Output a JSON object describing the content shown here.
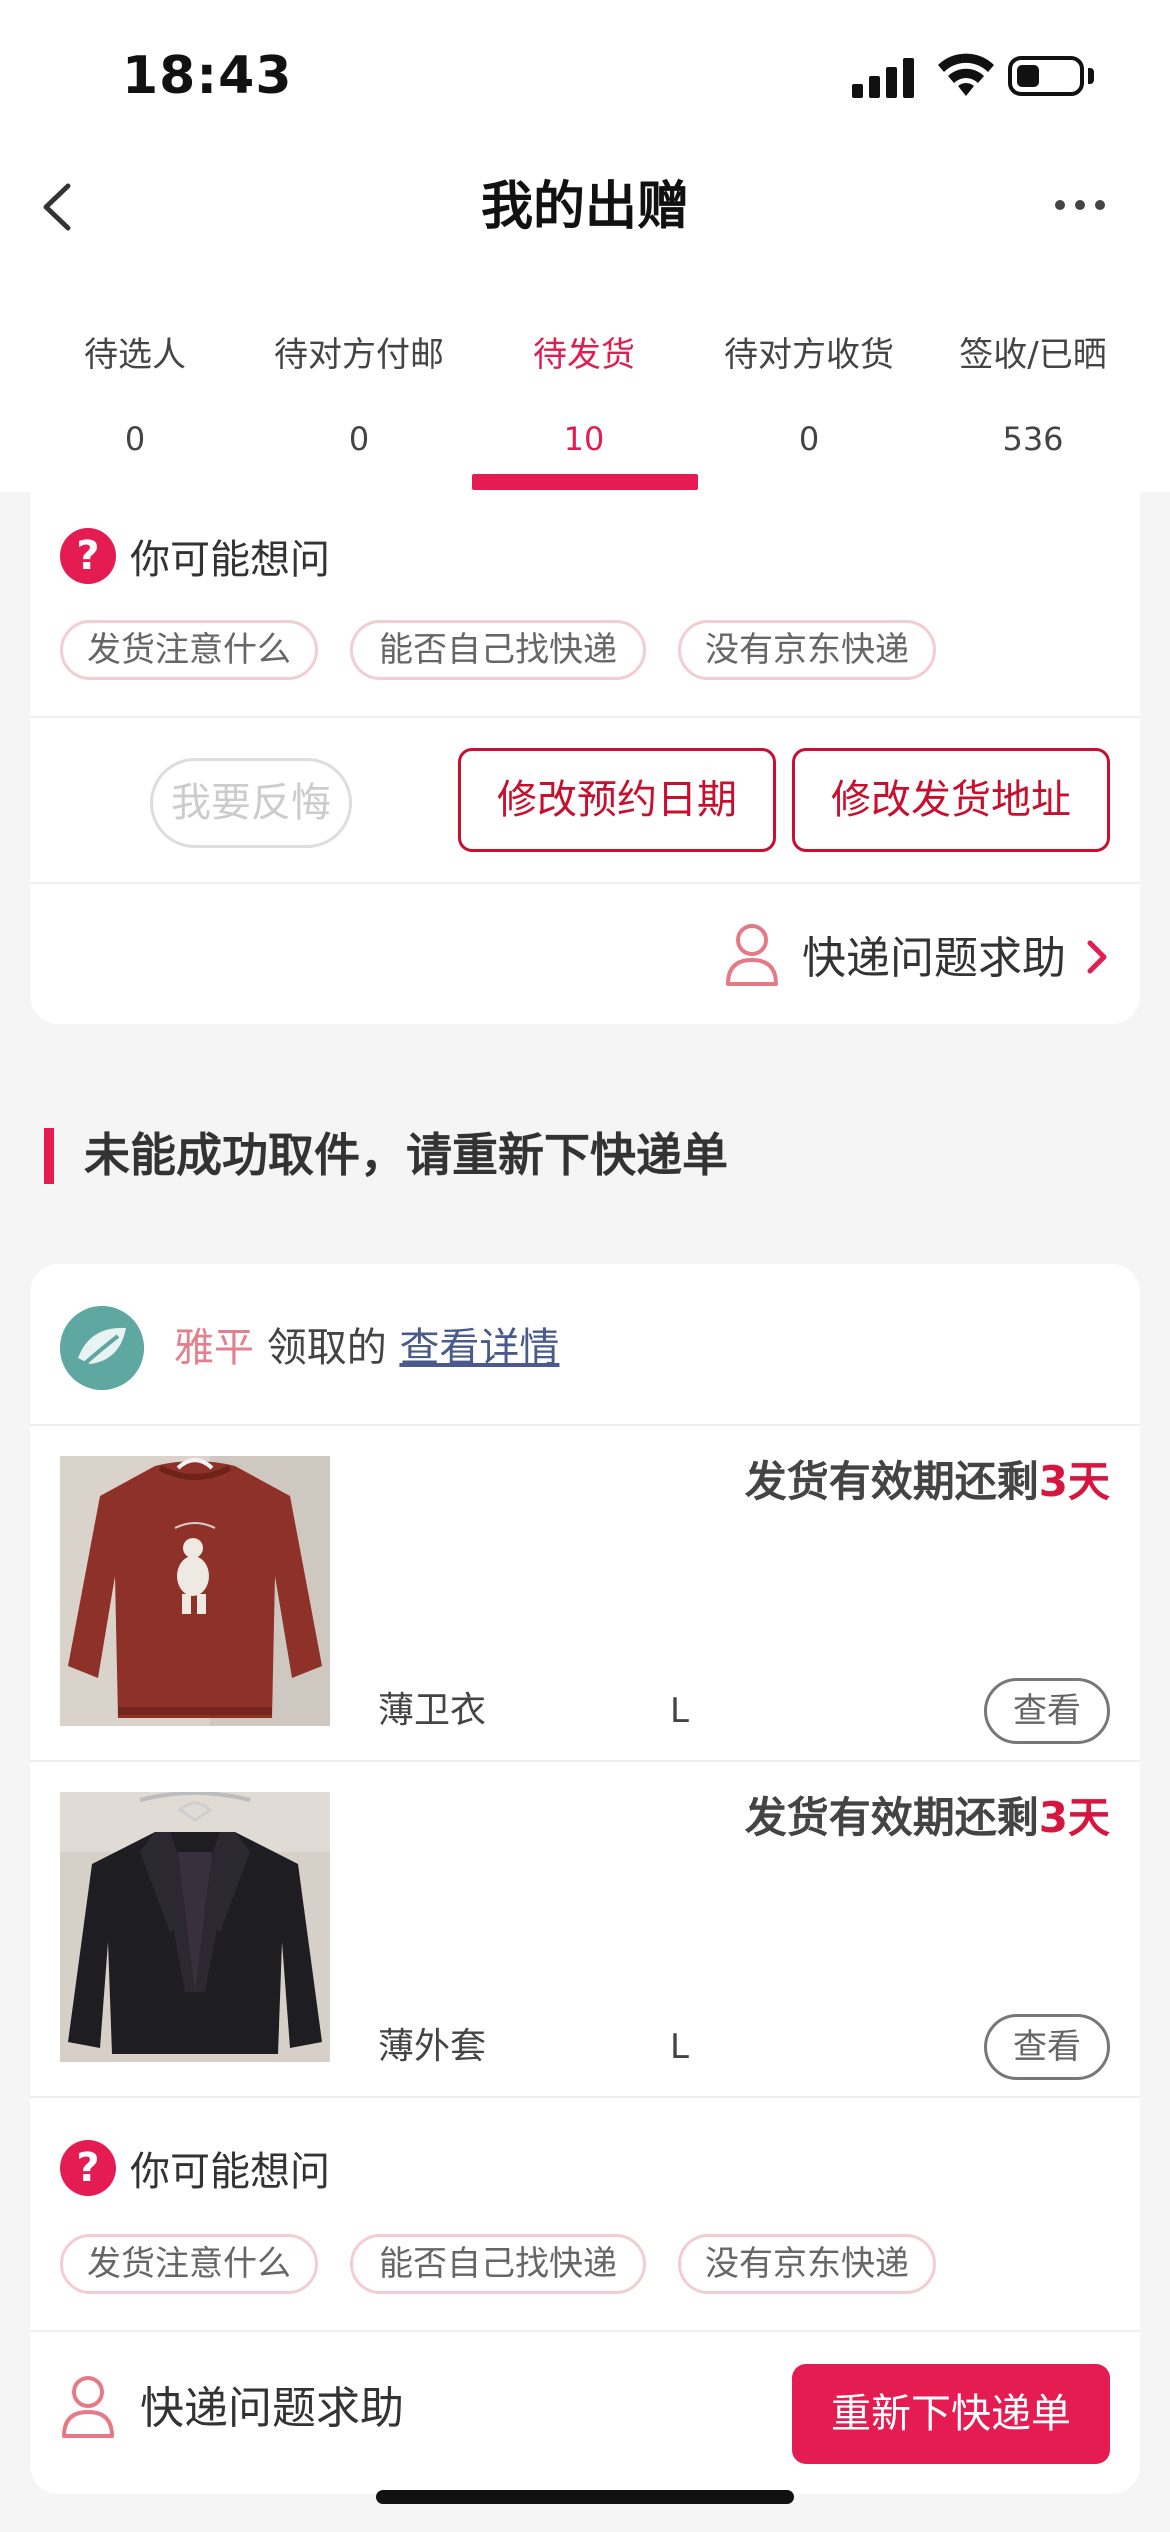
{
  "status_bar": {
    "time": "18:43"
  },
  "header": {
    "title": "我的出赠"
  },
  "tabs": [
    {
      "label": "待选人",
      "count": "0"
    },
    {
      "label": "待对方付邮",
      "count": "0"
    },
    {
      "label": "待发货",
      "count": "10",
      "active": true
    },
    {
      "label": "待对方收货",
      "count": "0"
    },
    {
      "label": "签收/已晒",
      "count": "536"
    }
  ],
  "card1": {
    "faq_title": "你可能想问",
    "chips": [
      "发货注意什么",
      "能否自己找快递",
      "没有京东快递"
    ],
    "regret_button": "我要反悔",
    "change_date_button": "修改预约日期",
    "change_address_button": "修改发货地址",
    "help_label": "快递问题求助"
  },
  "section": {
    "title": "未能成功取件，请重新下快递单"
  },
  "card2": {
    "claimer_name": "雅平",
    "claim_text": "领取的",
    "detail_link": "查看详情",
    "items": [
      {
        "deadline_prefix": "发货有效期还剩",
        "deadline_value": "3天",
        "name": "薄卫衣",
        "size": "L",
        "view_label": "查看"
      },
      {
        "deadline_prefix": "发货有效期还剩",
        "deadline_value": "3天",
        "name": "薄外套",
        "size": "L",
        "view_label": "查看"
      }
    ],
    "faq_title": "你可能想问",
    "chips": [
      "发货注意什么",
      "能否自己找快递",
      "没有京东快递"
    ],
    "help_label": "快递问题求助",
    "reorder_button": "重新下快递单"
  },
  "colors": {
    "accent": "#e51c52",
    "outline_red": "#c8102e",
    "claimer": "#e2808d",
    "link": "#4a5a8a"
  }
}
